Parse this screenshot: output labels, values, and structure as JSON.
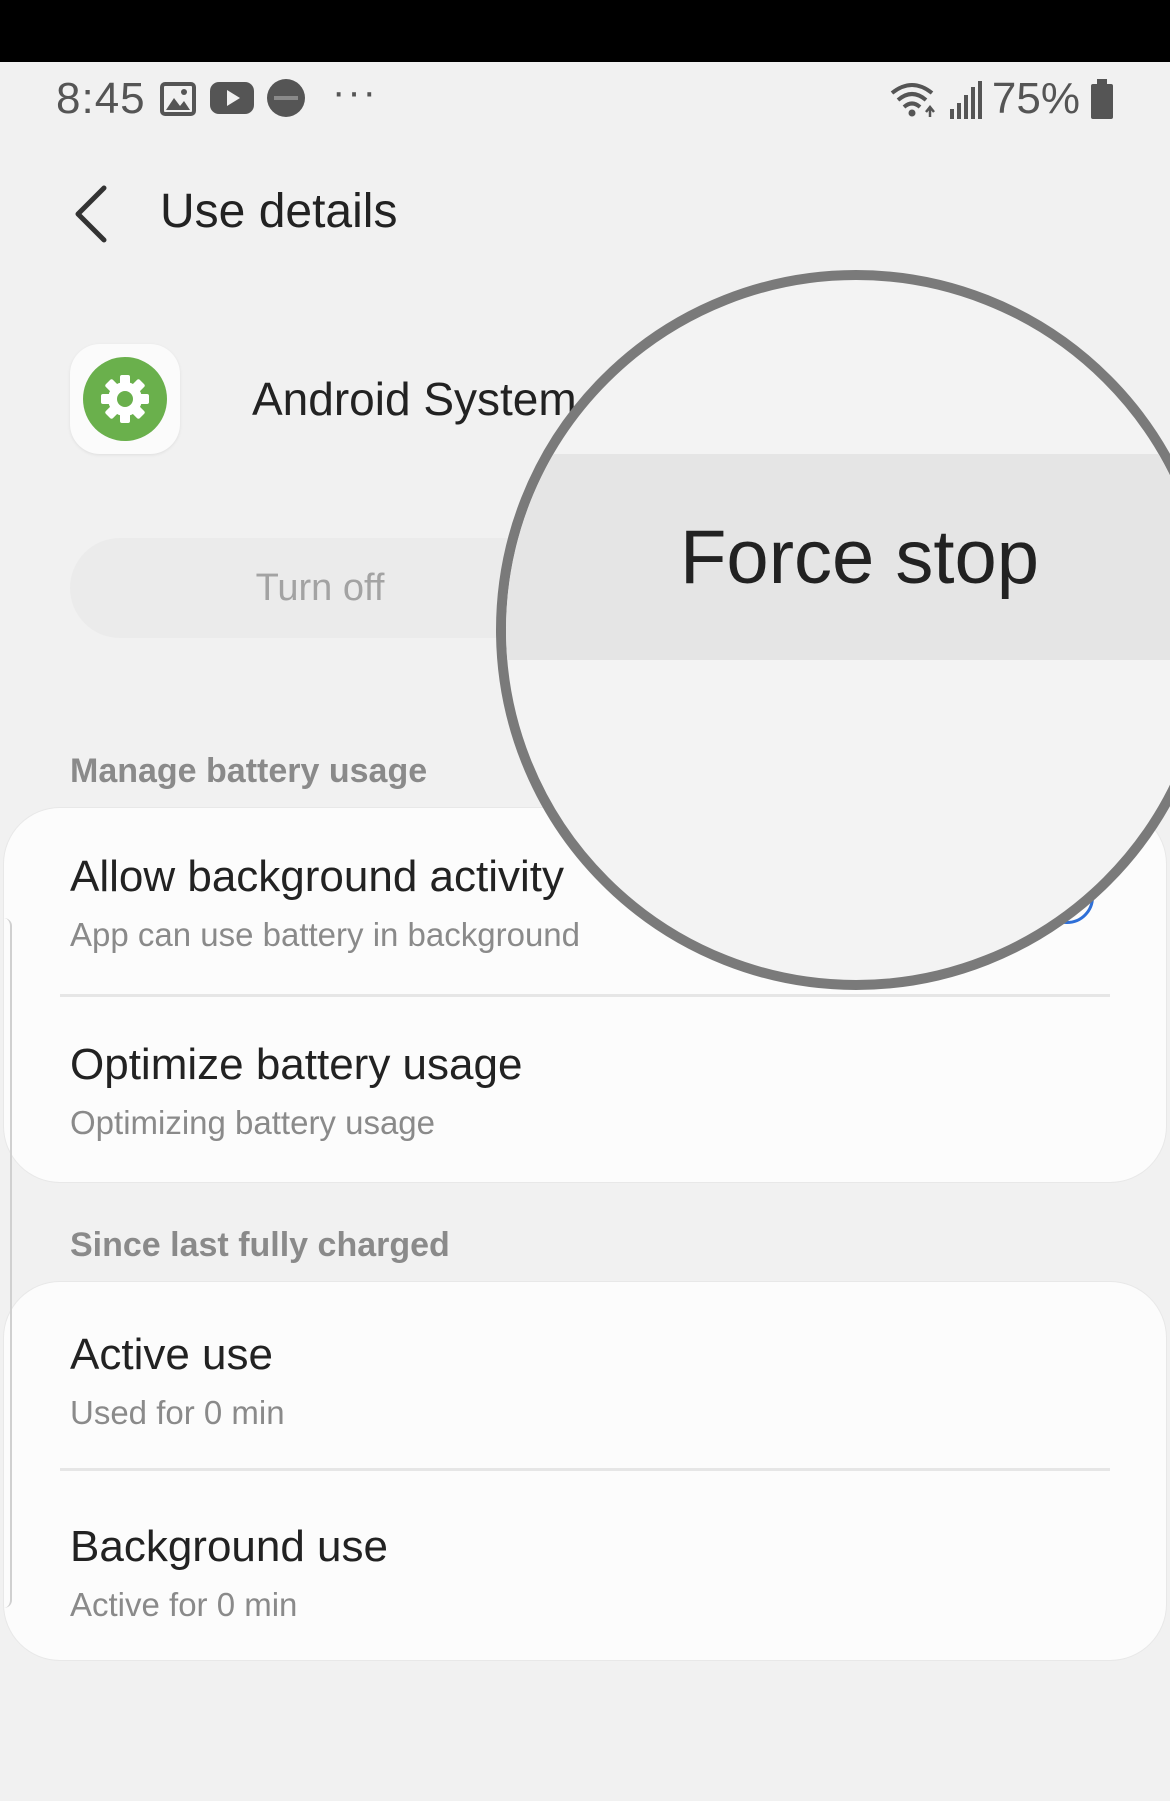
{
  "status_bar": {
    "time": "8:45",
    "notification_icons": [
      "gallery-icon",
      "youtube-icon",
      "verizon-icon"
    ],
    "more": "···",
    "battery_percent": "75%"
  },
  "header": {
    "title": "Use details",
    "back_icon": "chevron-left-icon"
  },
  "app": {
    "name": "Android System",
    "icon": "settings-gear-icon",
    "icon_color": "#6ab04c"
  },
  "actions": {
    "turn_off": "Turn off",
    "force_stop": "Force stop"
  },
  "sections": [
    {
      "label": "Manage battery usage",
      "items": [
        {
          "title": "Allow background activity",
          "subtitle": "App can use battery in background"
        },
        {
          "title": "Optimize battery usage",
          "subtitle": "Optimizing battery usage"
        }
      ]
    },
    {
      "label": "Since last fully charged",
      "items": [
        {
          "title": "Active use",
          "subtitle": "Used for 0 min"
        },
        {
          "title": "Background use",
          "subtitle": "Active for 0 min"
        }
      ]
    }
  ],
  "colors": {
    "accent": "#2e6fd8",
    "background": "#f1f1f1"
  }
}
